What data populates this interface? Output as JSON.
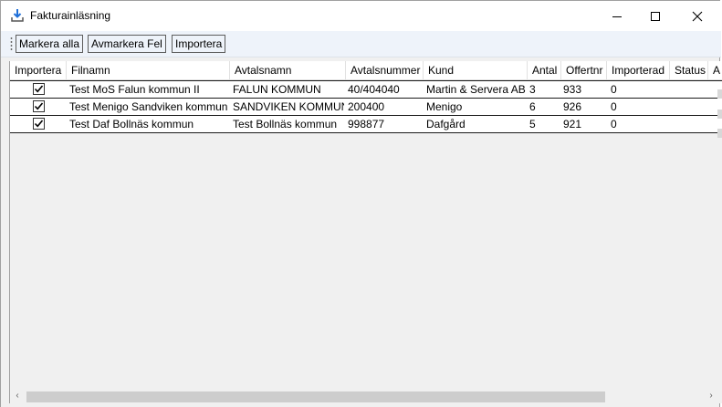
{
  "window": {
    "title": "Fakturainläsning",
    "controls": {
      "minimize": "minimize",
      "maximize": "maximize",
      "close": "close"
    }
  },
  "toolbar": {
    "buttons": [
      "Markera alla",
      "Avmarkera Fel",
      "Importera"
    ]
  },
  "table": {
    "columns": [
      "Importera",
      "Filnamn",
      "Avtalsnamn",
      "Avtalsnummer",
      "Kund",
      "Antal",
      "Offertnr",
      "Importerad",
      "Status",
      "A"
    ],
    "rows": [
      {
        "importera": true,
        "filnamn": "Test MoS Falun kommun II",
        "avtalsnamn": "FALUN KOMMUN",
        "avtalsnummer": "40/404040",
        "kund": "Martin & Servera AB",
        "antal": "3",
        "offertnr": "933",
        "importerad": "0",
        "status": ""
      },
      {
        "importera": true,
        "filnamn": "Test Menigo Sandviken kommun",
        "avtalsnamn": "SANDVIKEN KOMMUN",
        "avtalsnummer": "200400",
        "kund": "Menigo",
        "antal": "6",
        "offertnr": "926",
        "importerad": "0",
        "status": ""
      },
      {
        "importera": true,
        "filnamn": "Test Daf Bollnäs kommun",
        "avtalsnamn": "Test Bollnäs kommun",
        "avtalsnummer": "998877",
        "kund": "Dafgård",
        "antal": "5",
        "offertnr": "921",
        "importerad": "0",
        "status": ""
      }
    ]
  },
  "scrollbar": {
    "left_arrow": "‹",
    "right_arrow": "›"
  },
  "icons": {
    "app": "download-icon",
    "overflow": "toolbar-overflow-icon",
    "check": "checkmark-icon"
  }
}
